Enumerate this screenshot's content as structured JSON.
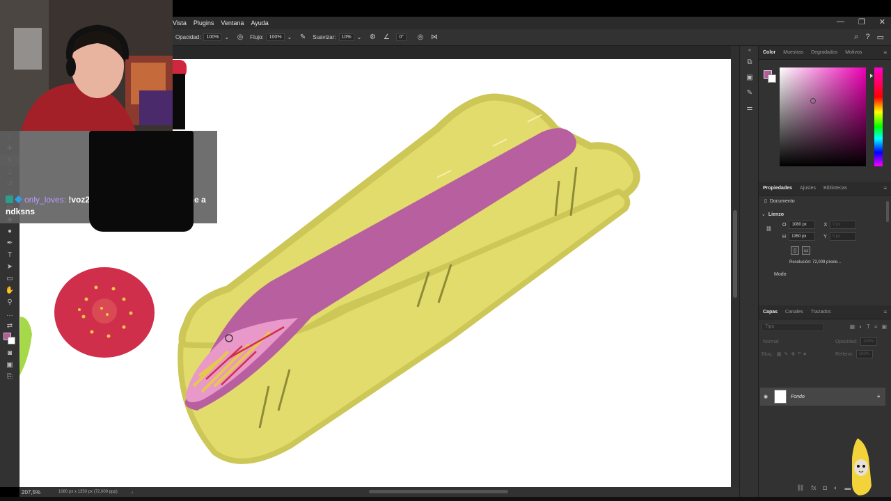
{
  "menubar": {
    "menus": [
      "Vista",
      "Plugins",
      "Ventana",
      "Ayuda"
    ]
  },
  "options": {
    "opacity_label": "Opacidad:",
    "opacity_value": "100%",
    "flow_label": "Flujo:",
    "flow_value": "100%",
    "smoothing_label": "Suavizar:",
    "smoothing_value": "10%",
    "angle_value": "0°"
  },
  "status": {
    "zoom": "207,5%",
    "doc_info": "1080 px x 1350 px (72,009 ppp)"
  },
  "color_panel": {
    "tabs": [
      "Color",
      "Muestras",
      "Degradados",
      "Motivos"
    ],
    "foreground": "#b55a9a",
    "background": "#ffffff"
  },
  "properties_panel": {
    "tabs": [
      "Propiedades",
      "Ajustes",
      "Bibliotecas"
    ],
    "doc_label": "Documento",
    "canvas_section": "Lienzo",
    "w_label": "O",
    "w_value": "1080 px",
    "h_label": "H",
    "h_value": "1350 px",
    "x_label": "X",
    "x_value": "0 px",
    "y_label": "Y",
    "y_value": "0 px",
    "resolution": "Resolución: 72,009 píxele...",
    "mode_label": "Modo"
  },
  "layers_panel": {
    "tabs": [
      "Capas",
      "Canales",
      "Trazados"
    ],
    "search_placeholder": "Tipo",
    "blend_mode": "Normal",
    "opacity_label": "Opacidad:",
    "opacity_value": "100%",
    "lock_label": "Bloq.:",
    "fill_label": "Relleno:",
    "fill_value": "100%",
    "layers": [
      {
        "name": "Fondo"
      }
    ]
  },
  "overlay": {
    "chat_user": "only_loves:",
    "chat_message": "!voz2 el que lo dibujo se lo come a ndksns"
  }
}
